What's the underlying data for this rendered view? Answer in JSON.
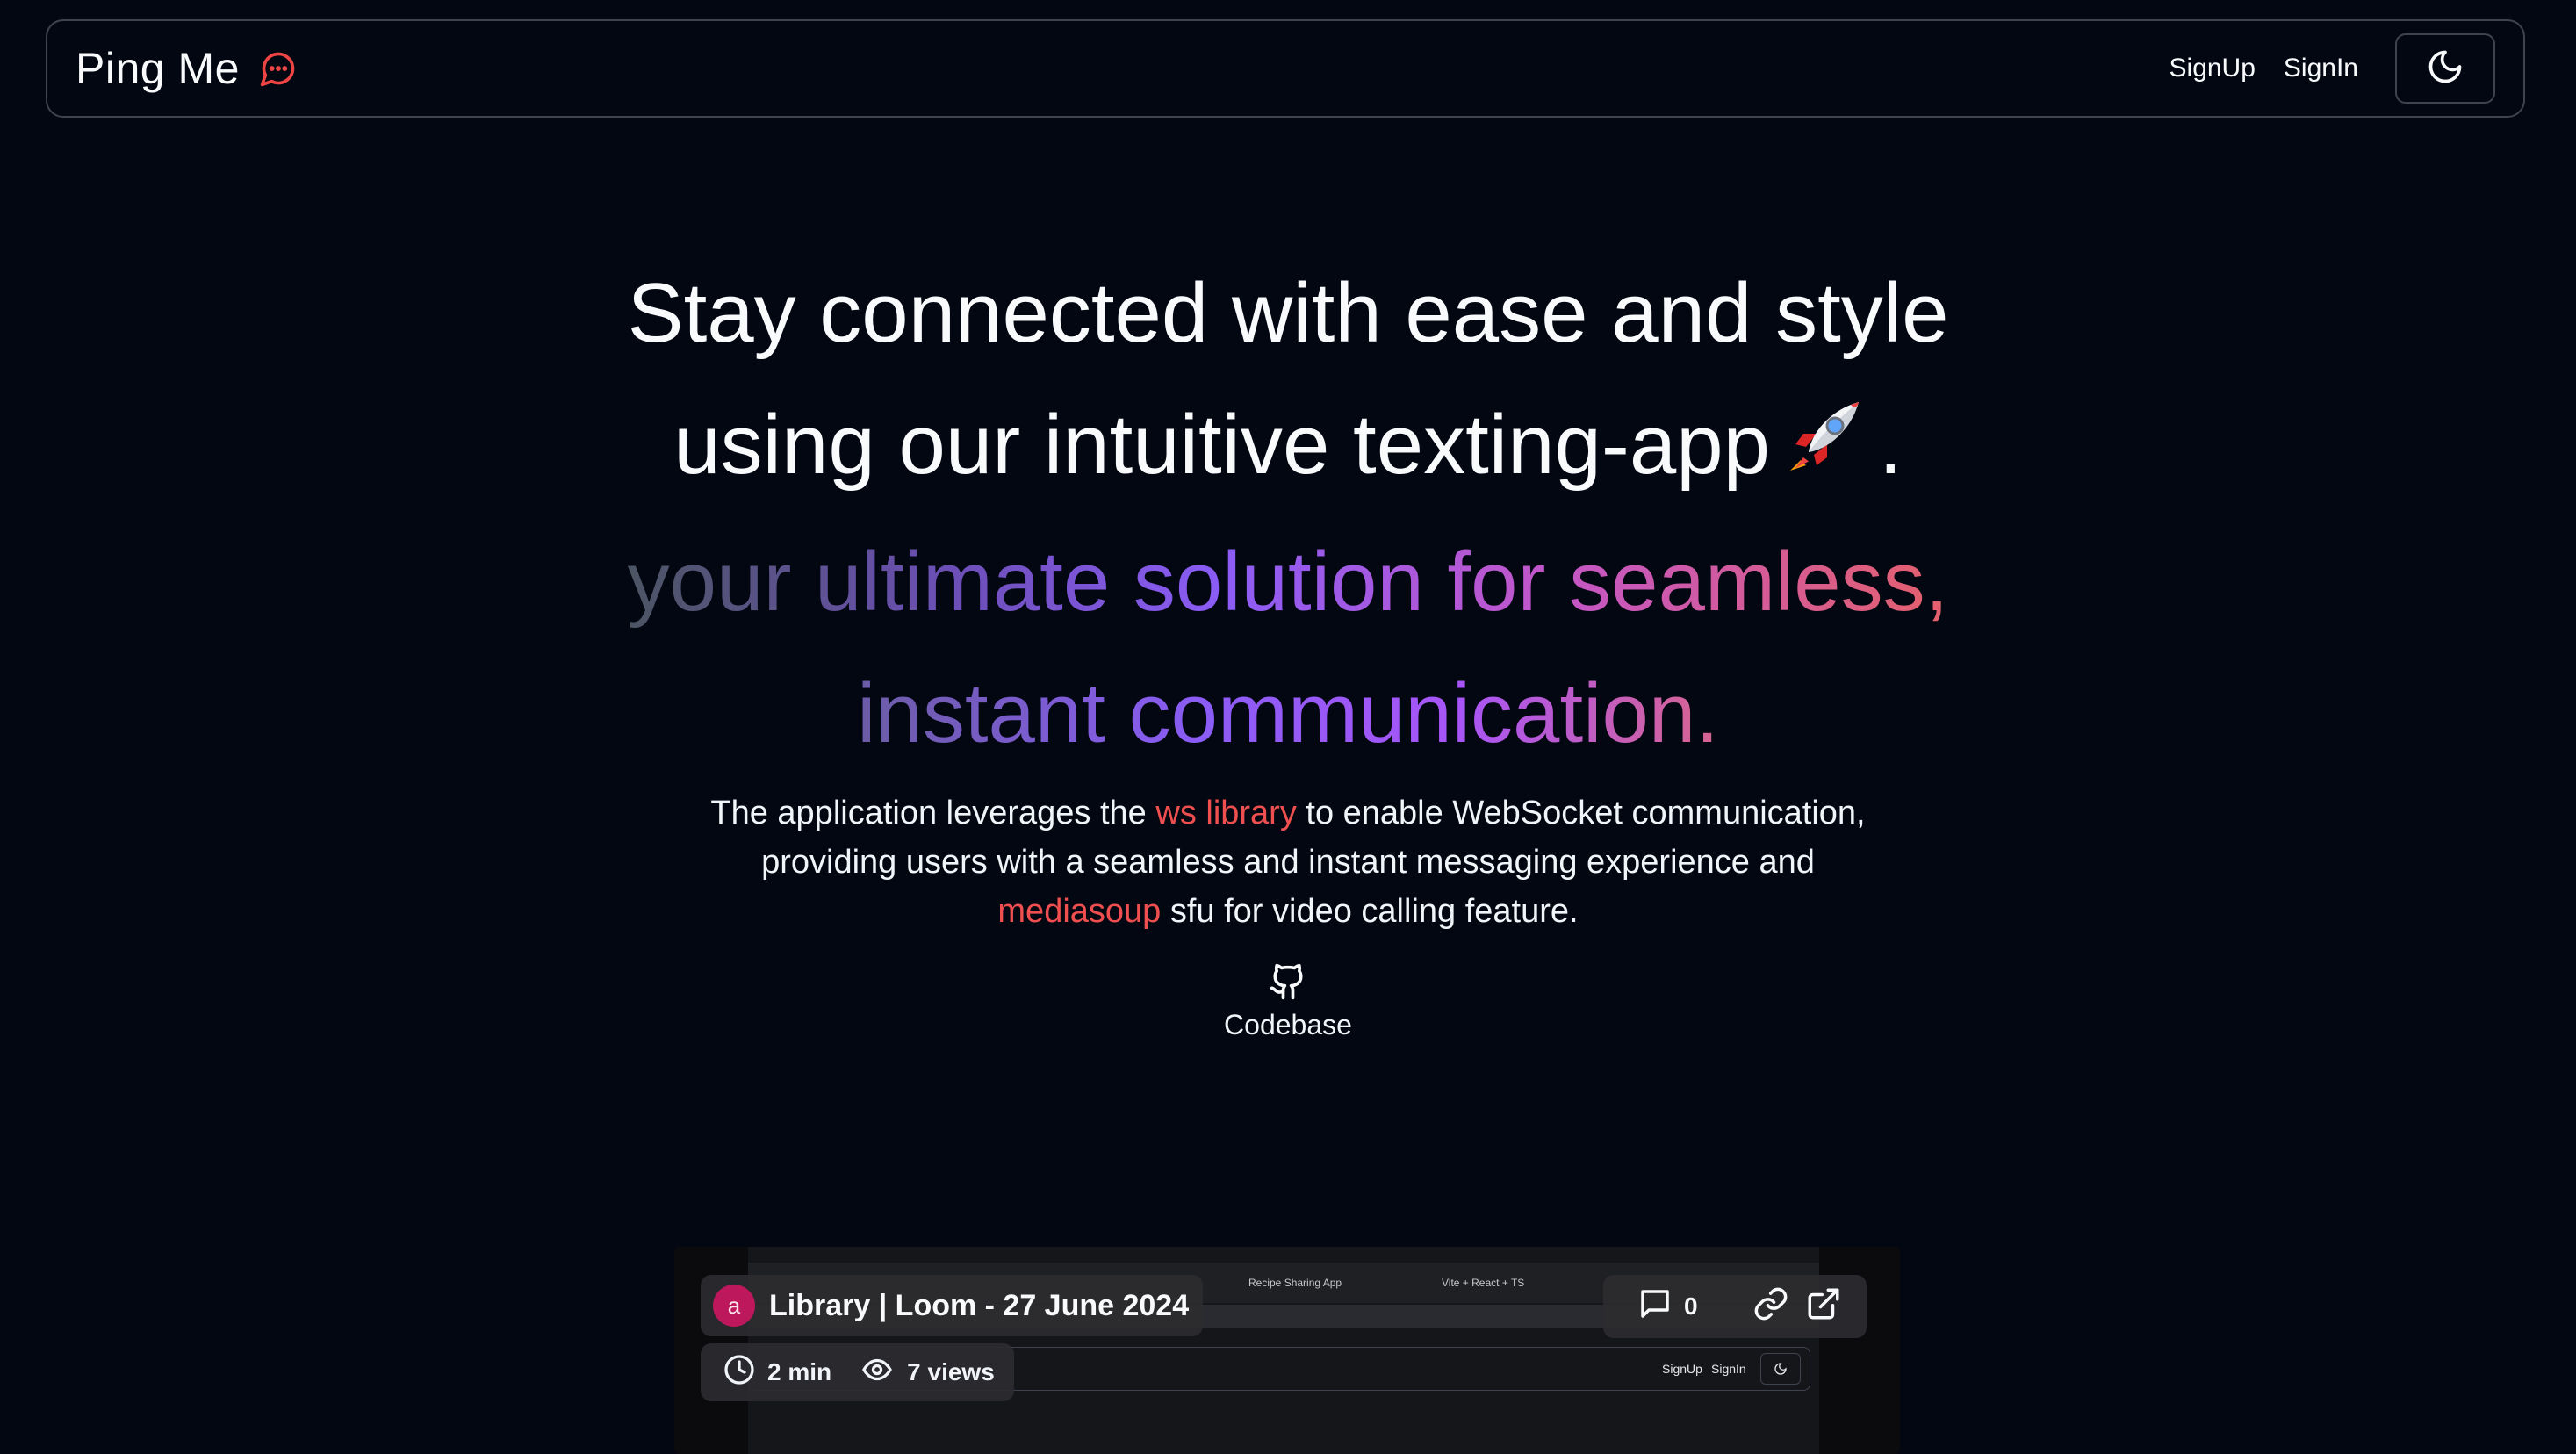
{
  "navbar": {
    "brand": "Ping Me",
    "links": [
      "SignUp",
      "SignIn"
    ],
    "theme_toggle_icon": "moon-icon"
  },
  "hero": {
    "line1": "Stay connected with ease and style",
    "line2": "using our intuitive texting-app",
    "line2_emoji": "rocket-icon",
    "line2_end": ".",
    "line3": "your ultimate solution for seamless,",
    "line4": "instant communication."
  },
  "description": {
    "part1": "The application leverages the ",
    "link1": "ws library",
    "part2": " to enable WebSocket communication,",
    "part3": "providing users with a seamless and instant messaging experience and",
    "link2": "mediasoup",
    "part4": " sfu for video calling feature."
  },
  "codebase": {
    "label": "Codebase",
    "icon": "github-icon"
  },
  "video": {
    "avatar_letter": "a",
    "title": "Library | Loom - 27 June 2024",
    "duration": "2 min",
    "views": "7 views",
    "comments_count": "0",
    "inner_tabs": [
      "Recipe Sharing App",
      "Vite + React + TS"
    ],
    "inner_nav_links": [
      "SignUp",
      "SignIn"
    ]
  },
  "colors": {
    "background": "#030712",
    "accent": "#ef4f4f",
    "avatar": "#be185d"
  }
}
